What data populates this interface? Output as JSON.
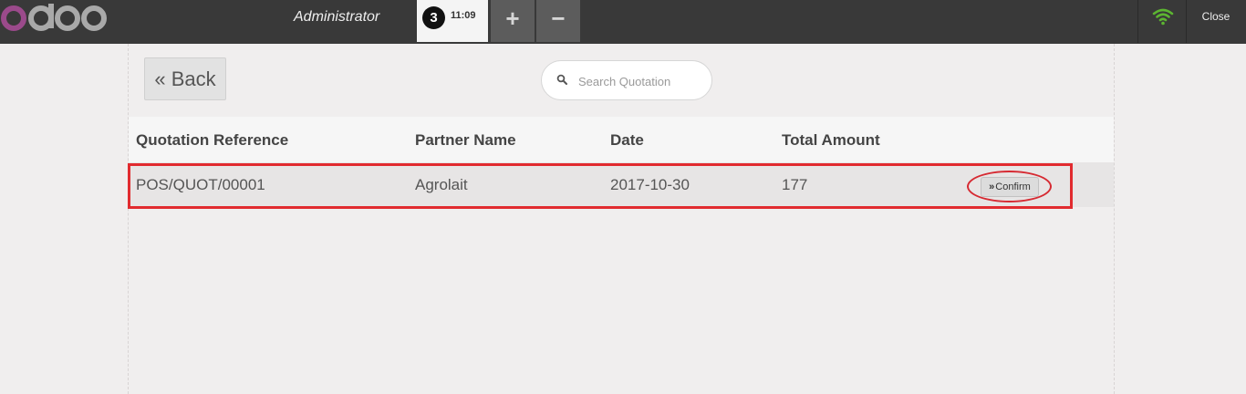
{
  "header": {
    "logo_text": "odoo",
    "cashier": "Administrator",
    "order": {
      "sequence": "3",
      "time": "11:09"
    },
    "add_order_label": "+",
    "remove_order_label": "−",
    "wifi_icon": "wifi-icon",
    "close_label": "Close",
    "colors": {
      "bar": "#393939",
      "wifi": "#5cb531",
      "logo_o": "#9b4a8b",
      "logo_rest": "#a9a9a9"
    }
  },
  "screen": {
    "back_label": "« Back",
    "search": {
      "placeholder": "Search Quotation",
      "value": ""
    },
    "columns": [
      "Quotation Reference",
      "Partner Name",
      "Date",
      "Total Amount"
    ],
    "rows": [
      {
        "reference": "POS/QUOT/00001",
        "partner": "Agrolait",
        "date": "2017-10-30",
        "total": "177",
        "action_label": "Confirm"
      }
    ]
  },
  "annotations": {
    "highlight_color": "#e12b2f"
  }
}
